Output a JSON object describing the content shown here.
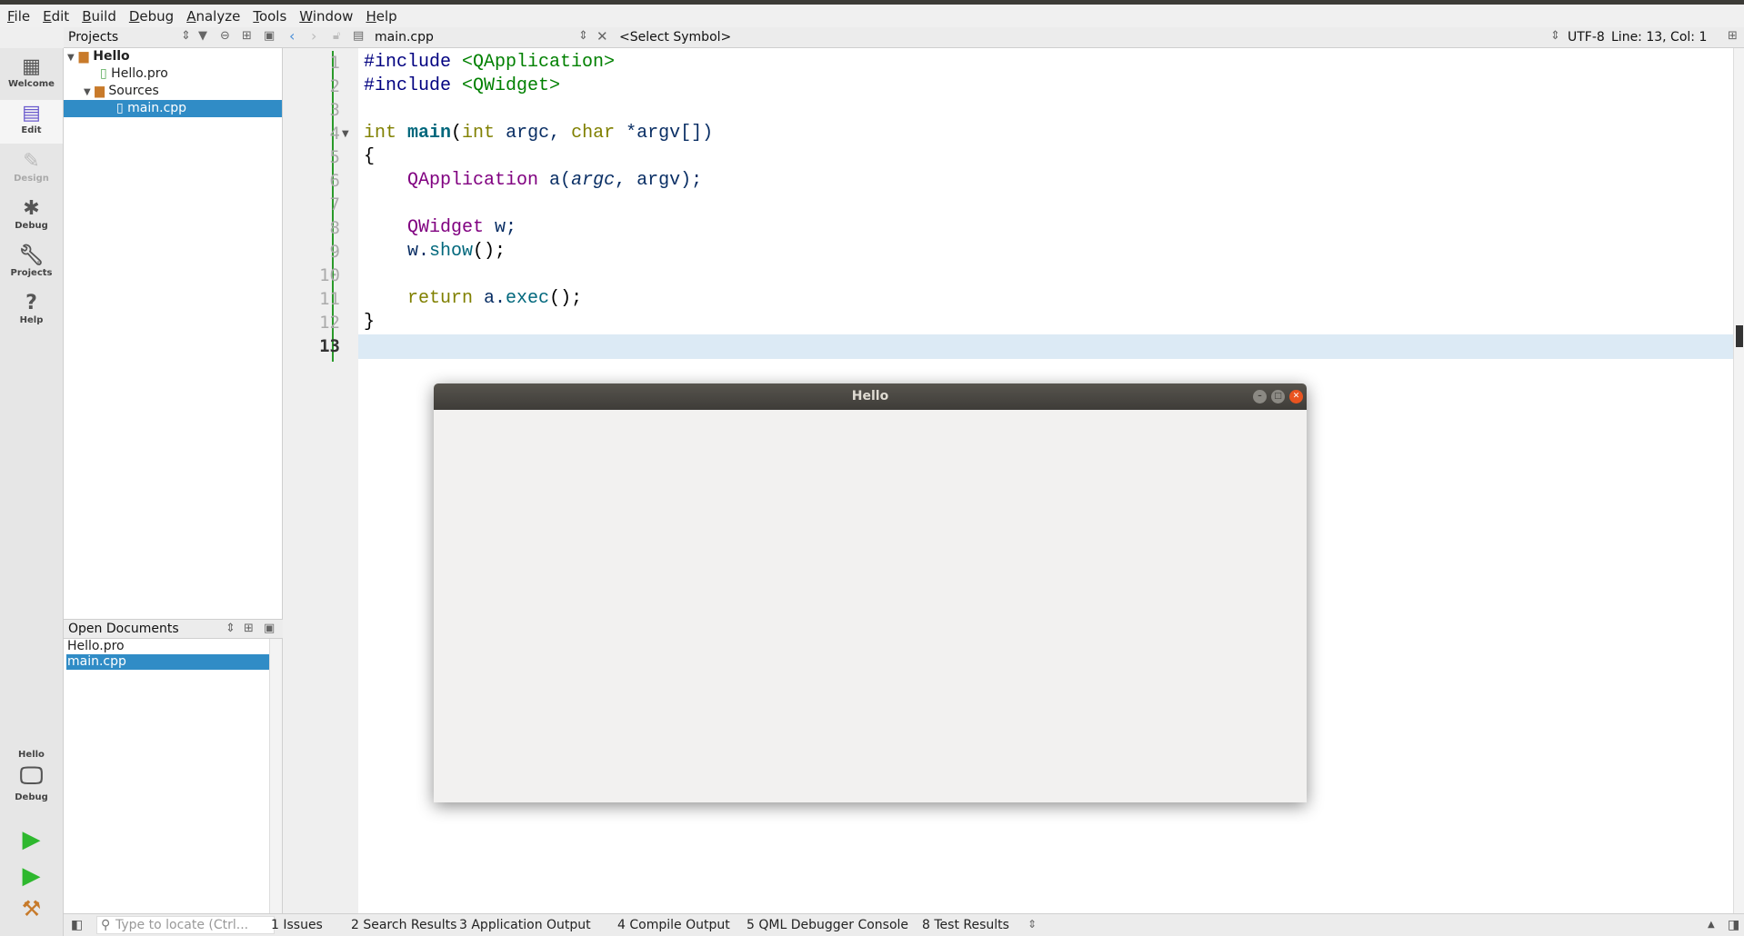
{
  "menu": [
    "File",
    "Edit",
    "Build",
    "Debug",
    "Analyze",
    "Tools",
    "Window",
    "Help"
  ],
  "toolbar": {
    "projects_label": "Projects",
    "file_name": "main.cpp",
    "symbol": "<Select Symbol>",
    "encoding": "UTF-8",
    "position": "Line: 13, Col: 1"
  },
  "modes": [
    {
      "label": "Welcome",
      "icon": "grid-icon"
    },
    {
      "label": "Edit",
      "icon": "document-icon"
    },
    {
      "label": "Design",
      "icon": "pencil-icon"
    },
    {
      "label": "Debug",
      "icon": "bug-icon"
    },
    {
      "label": "Projects",
      "icon": "wrench-icon"
    },
    {
      "label": "Help",
      "icon": "help-icon"
    }
  ],
  "kit": {
    "project": "Hello",
    "build": "Debug"
  },
  "tree": {
    "project": "Hello",
    "pro": "Hello.pro",
    "sources": "Sources",
    "main": "main.cpp"
  },
  "open_documents": {
    "title": "Open Documents",
    "items": [
      "Hello.pro",
      "main.cpp"
    ]
  },
  "code_lines": [
    "1",
    "2",
    "3",
    "4",
    "5",
    "6",
    "7",
    "8",
    "9",
    "10",
    "11",
    "12",
    "13"
  ],
  "code": {
    "l1a": "#include ",
    "l1b": "<QApplication>",
    "l2a": "#include ",
    "l2b": "<QWidget>",
    "l4a": "int ",
    "l4b": "main",
    "l4c": "(",
    "l4d": "int ",
    "l4e": "argc, ",
    "l4f": "char ",
    "l4g": "*argv[])",
    "l5": "{",
    "l6a": "    ",
    "l6b": "QApplication ",
    "l6c": "a(",
    "l6d": "argc",
    "l6e": ", argv);",
    "l8a": "    ",
    "l8b": "QWidget ",
    "l8c": "w;",
    "l9a": "    w.",
    "l9b": "show",
    "l9c": "();",
    "l11a": "    ",
    "l11b": "return ",
    "l11c": "a.",
    "l11d": "exec",
    "l11e": "();",
    "l12": "}"
  },
  "status": {
    "locate_placeholder": "Type to locate (Ctrl...",
    "tabs": [
      "1 Issues",
      "2 Search Results",
      "3 Application Output",
      "4 Compile Output",
      "5 QML Debugger Console",
      "8 Test Results"
    ]
  },
  "app_window": {
    "title": "Hello"
  },
  "colors": {
    "selection": "#308cc6",
    "current_line": "#dceaf5",
    "run": "#2eb82e"
  }
}
